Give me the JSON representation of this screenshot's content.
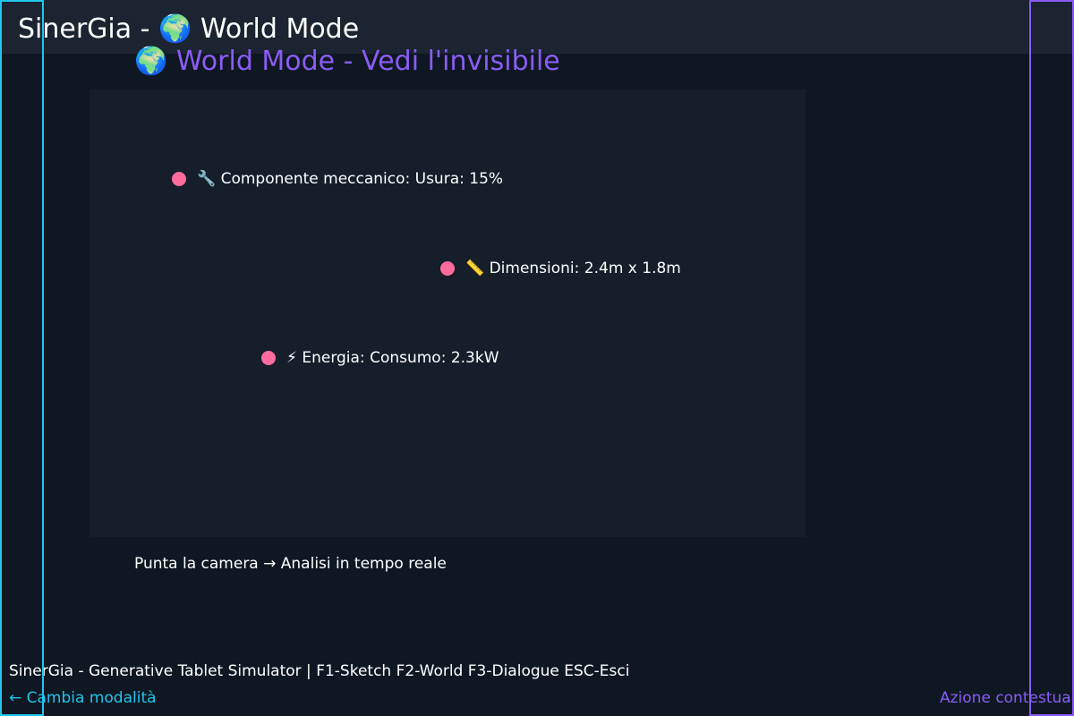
{
  "app": {
    "title": "SinerGia - 🌍 World Mode"
  },
  "mode": {
    "heading": "🌍 World Mode - Vedi l'invisibile"
  },
  "viewport": {
    "hotspots": [
      {
        "icon": "gear-icon",
        "label": "🔧 Componente meccanico: Usura: 15%"
      },
      {
        "icon": "ruler-icon",
        "label": "📏 Dimensioni: 2.4m x 1.8m"
      },
      {
        "icon": "lightning-icon",
        "label": "⚡ Energia: Consumo: 2.3kW"
      }
    ]
  },
  "hint": "Punta la camera → Analisi in tempo reale",
  "statusbar": "SinerGia - Generative Tablet Simulator | F1-Sketch F2-World F3-Dialogue ESC-Esci",
  "nav": {
    "left_label": "← Cambia modalità",
    "right_label": "Azione contestuale"
  },
  "colors": {
    "background": "#0f1822",
    "titlebar": "#1b2430",
    "viewport": "#151e29",
    "accent_purple": "#8b5cf6",
    "accent_cyan": "#22c5ee",
    "hotspot_pink": "#ff6b9d",
    "text": "#ffffff"
  }
}
